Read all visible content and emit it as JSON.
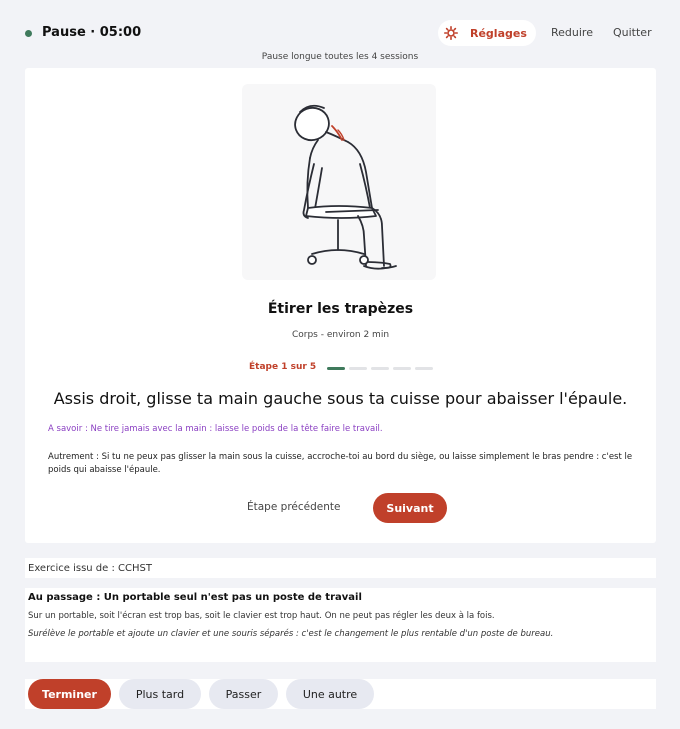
{
  "header": {
    "timer": "Pause · 05:00",
    "settings_label": "Réglages",
    "reduce_label": "Reduire",
    "quit_label": "Quitter",
    "subtitle": "Pause longue toutes les 4 sessions",
    "status_color": "#3f7a5c",
    "accent_color": "#c0402a"
  },
  "exercise": {
    "title": "Étirer les trapèzes",
    "meta": "Corps - environ 2 min",
    "step_label": "Étape 1 sur 5",
    "step_current": 1,
    "step_total": 5,
    "instruction": "Assis droit, glisse ta main gauche sous ta cuisse pour abaisser l'épaule.",
    "tip": "A savoir : Ne tire jamais avec la main : laisse le poids de la tête faire le travail.",
    "alternative": "Autrement : Si tu ne peux pas glisser la main sous la cuisse, accroche-toi au bord du siège, ou laisse simplement le bras pendre : c'est le poids qui abaisse l'épaule.",
    "prev_label": "Étape précédente",
    "next_label": "Suivant",
    "illustration_icon": "seated-neck-stretch-illustration"
  },
  "source": {
    "text": "Exercice issu de : CCHST"
  },
  "did_you_know": {
    "title": "Au passage : Un portable seul n'est pas un poste de travail",
    "text": "Sur un portable, soit l'écran est trop bas, soit le clavier est trop haut. On ne peut pas régler les deux à la fois.",
    "advice": "Surélève le portable et ajoute un clavier et une souris séparés : c'est le changement le plus rentable d'un poste de bureau."
  },
  "footer": {
    "finish_label": "Terminer",
    "later_label": "Plus tard",
    "skip_label": "Passer",
    "another_label": "Une autre"
  }
}
